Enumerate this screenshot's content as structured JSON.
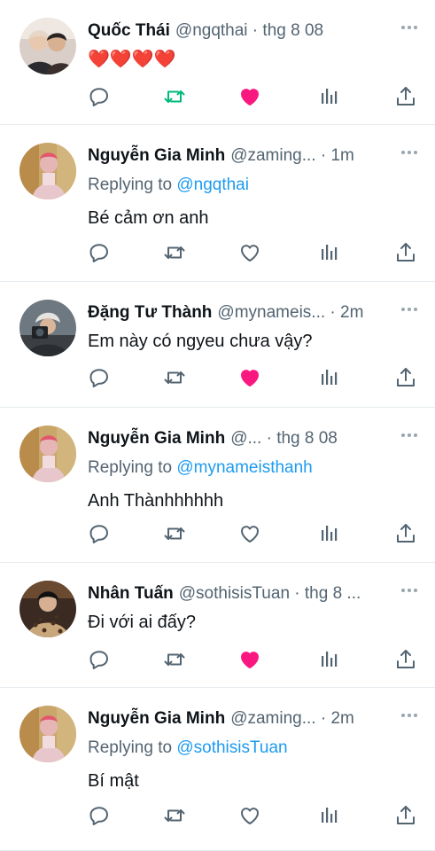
{
  "colors": {
    "like": "#f91880",
    "retweet": "#00ba7c",
    "link": "#1d9bf0",
    "muted": "#536471"
  },
  "tweets": [
    {
      "name": "Quốc Thái",
      "handle": "@ngqthai · thg 8 08",
      "reply_prefix": "",
      "reply_to": "",
      "text": "❤️❤️❤️❤️",
      "liked": true,
      "retweeted": true
    },
    {
      "name": "Nguyễn Gia Minh",
      "handle": "@zaming... · 1m",
      "reply_prefix": "Replying to ",
      "reply_to": "@ngqthai",
      "text": "Bé cảm ơn anh",
      "liked": false,
      "retweeted": false
    },
    {
      "name": "Đặng Tư Thành",
      "handle": "@mynameis... · 2m",
      "reply_prefix": "",
      "reply_to": "",
      "text": "Em này có ngyeu chưa vậy?",
      "liked": true,
      "retweeted": false
    },
    {
      "name": "Nguyễn Gia Minh",
      "handle": "@... · thg 8 08",
      "reply_prefix": "Replying to ",
      "reply_to": "@mynameisthanh",
      "text": "Anh Thànhhhhhh",
      "liked": false,
      "retweeted": false
    },
    {
      "name": "Nhân Tuấn",
      "handle": "@sothisisTuan · thg 8 ...",
      "reply_prefix": "",
      "reply_to": "",
      "text": "Đi với ai đấy?",
      "liked": true,
      "retweeted": false
    },
    {
      "name": "Nguyễn Gia Minh",
      "handle": "@zaming... · 2m",
      "reply_prefix": "Replying to ",
      "reply_to": "@sothisisTuan",
      "text": "Bí mật",
      "liked": false,
      "retweeted": false
    }
  ],
  "icons": {
    "reply": "reply-icon",
    "retweet": "retweet-icon",
    "like": "heart-icon",
    "views": "views-icon",
    "share": "share-icon",
    "more": "more-icon"
  }
}
